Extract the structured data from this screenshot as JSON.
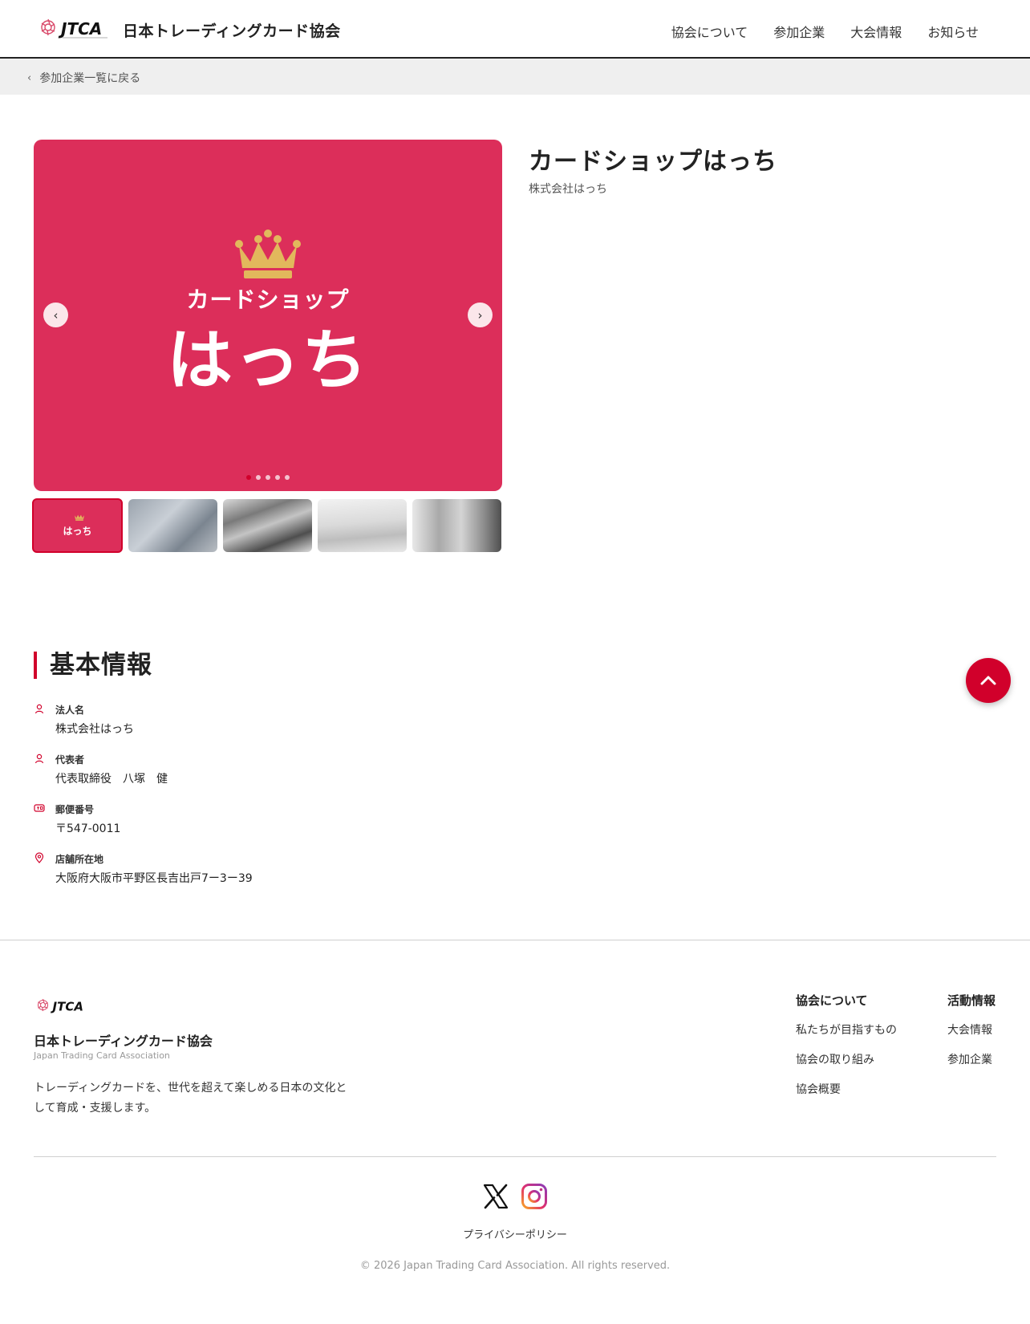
{
  "header": {
    "logo_text": "JTCA",
    "site_title": "日本トレーディングカード協会",
    "nav": [
      {
        "label": "協会について"
      },
      {
        "label": "参加企業"
      },
      {
        "label": "大会情報"
      },
      {
        "label": "お知らせ"
      }
    ]
  },
  "breadcrumb": {
    "back_label": "参加企業一覧に戻る"
  },
  "shop": {
    "name": "カードショップはっち",
    "company": "株式会社はっち",
    "slide": {
      "subtitle": "カードショップ",
      "title": "はっち",
      "total_slides": 5,
      "active_slide": 1
    },
    "thumbnail_logo_text": "はっち"
  },
  "basic_info": {
    "title": "基本情報",
    "items": [
      {
        "icon": "person-icon",
        "label": "法人名",
        "value": "株式会社はっち"
      },
      {
        "icon": "person-icon",
        "label": "代表者",
        "value": "代表取締役　八塚　健"
      },
      {
        "icon": "postal-icon",
        "label": "郵便番号",
        "value": "〒547-0011"
      },
      {
        "icon": "location-pin-icon",
        "label": "店舗所在地",
        "value": "大阪府大阪市平野区長吉出戸7ー3ー39"
      }
    ]
  },
  "footer": {
    "org_name": "日本トレーディングカード協会",
    "org_name_en": "Japan Trading Card Association",
    "description": "トレーディングカードを、世代を超えて楽しめる日本の文化として育成・支援します。",
    "columns": [
      {
        "title": "協会について",
        "links": [
          "私たちが目指すもの",
          "協会の取り組み",
          "協会概要"
        ]
      },
      {
        "title": "活動情報",
        "links": [
          "大会情報",
          "参加企業"
        ]
      }
    ],
    "privacy": "プライバシーポリシー",
    "copyright": "© 2026 Japan Trading Card Association. All rights reserved."
  },
  "colors": {
    "accent": "#d1002b",
    "slide_bg": "#dc2e5a",
    "crown": "#e2b85c"
  }
}
